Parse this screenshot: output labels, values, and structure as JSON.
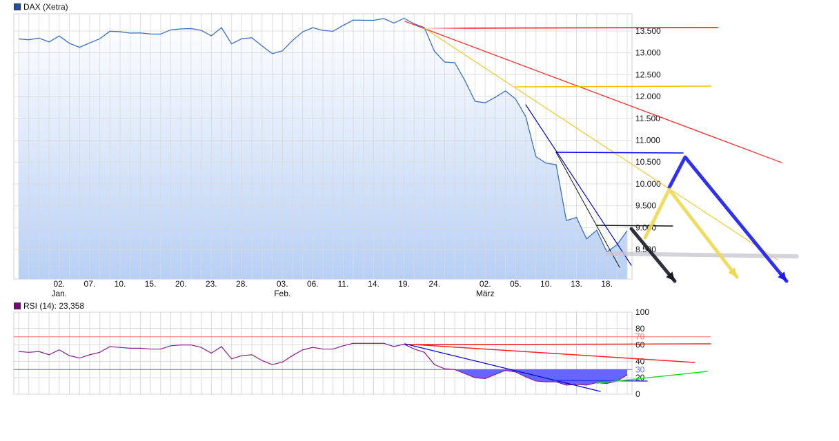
{
  "chart_data": [
    {
      "type": "area",
      "legend": "DAX (Xetra)",
      "legend_color": "#1f4fa8",
      "line_color": "#3a6fc4",
      "ylim": [
        7822,
        13894
      ],
      "grid": true,
      "y_ticks": [
        8500,
        9000,
        9500,
        10000,
        10500,
        11000,
        11500,
        12000,
        12500,
        13000,
        13500
      ],
      "y_tick_labels": [
        "8.500",
        "9.000",
        "9.500",
        "10.000",
        "10.500",
        "11.000",
        "11.500",
        "12.000",
        "12.500",
        "13.000",
        "13.500"
      ],
      "x_ticks": [
        {
          "index": 4,
          "label": "02.",
          "month": "Jan."
        },
        {
          "index": 7,
          "label": "07."
        },
        {
          "index": 10,
          "label": "10."
        },
        {
          "index": 13,
          "label": "15."
        },
        {
          "index": 16,
          "label": "20."
        },
        {
          "index": 19,
          "label": "23."
        },
        {
          "index": 22,
          "label": "28."
        },
        {
          "index": 26,
          "label": "03.",
          "month": "Feb."
        },
        {
          "index": 29,
          "label": "06."
        },
        {
          "index": 32,
          "label": "11."
        },
        {
          "index": 35,
          "label": "14."
        },
        {
          "index": 38,
          "label": "19."
        },
        {
          "index": 41,
          "label": "24."
        },
        {
          "index": 46,
          "label": "02.",
          "month": "März"
        },
        {
          "index": 49,
          "label": "05."
        },
        {
          "index": 52,
          "label": "10."
        },
        {
          "index": 55,
          "label": "13."
        },
        {
          "index": 58,
          "label": "18."
        }
      ],
      "values": [
        13319,
        13300,
        13337,
        13249,
        13386,
        13219,
        13127,
        13227,
        13321,
        13495,
        13483,
        13452,
        13456,
        13432,
        13430,
        13526,
        13549,
        13556,
        13515,
        13389,
        13577,
        13205,
        13324,
        13345,
        13158,
        12982,
        13046,
        13282,
        13479,
        13575,
        13514,
        13494,
        13628,
        13750,
        13745,
        13744,
        13784,
        13682,
        13790,
        13665,
        13579,
        13035,
        12791,
        12775,
        12367,
        11891,
        11857,
        11985,
        12128,
        11944,
        11542,
        10625,
        10475,
        10439,
        9161,
        9232,
        8742,
        8939,
        8442,
        8610,
        8929
      ]
    },
    {
      "type": "line",
      "legend": "RSI (14): 23,358",
      "legend_color": "#800080",
      "line_color": "#8b1a8b",
      "ylim": [
        0,
        100
      ],
      "grid": true,
      "y_ticks": [
        0,
        20,
        40,
        60,
        80,
        100
      ],
      "levels": [
        {
          "value": 70,
          "label": "70",
          "color": "#ff6666"
        },
        {
          "value": 30,
          "label": "30",
          "color": "#6666ff"
        }
      ],
      "fill_below_30_color": "#6666ff",
      "values": [
        52,
        51,
        52,
        48,
        54,
        47,
        44,
        48,
        51,
        58,
        57,
        56,
        56,
        55,
        55,
        59,
        60,
        60,
        57,
        50,
        58,
        43,
        47,
        48,
        41,
        36,
        39,
        47,
        54,
        57,
        55,
        55,
        59,
        62,
        62,
        62,
        62,
        58,
        61,
        55,
        51,
        36,
        31,
        30,
        25,
        20,
        19,
        24,
        29,
        27,
        21,
        16,
        15,
        15,
        11,
        12,
        11,
        14,
        13,
        16,
        23.4
      ]
    }
  ]
}
